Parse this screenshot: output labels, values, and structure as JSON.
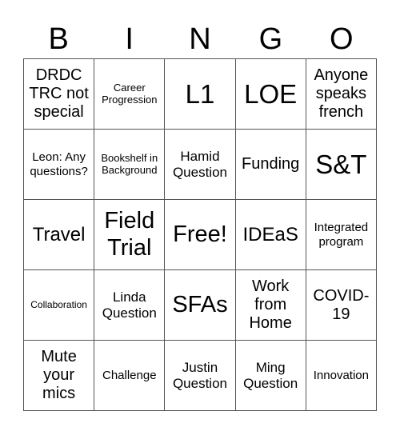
{
  "header": [
    "B",
    "I",
    "N",
    "G",
    "O"
  ],
  "rows": [
    [
      "DRDC TRC not special",
      "Career Progression",
      "L1",
      "LOE",
      "Anyone speaks french"
    ],
    [
      "Leon: Any questions?",
      "Bookshelf in Background",
      "Hamid Question",
      "Funding",
      "S&T"
    ],
    [
      "Travel",
      "Field Trial",
      "Free!",
      "IDEaS",
      "Integrated program"
    ],
    [
      "Collaboration",
      "Linda Question",
      "SFAs",
      "Work from Home",
      "COVID-19"
    ],
    [
      "Mute your mics",
      "Challenge",
      "Justin Question",
      "Ming Question",
      "Innovation"
    ]
  ]
}
